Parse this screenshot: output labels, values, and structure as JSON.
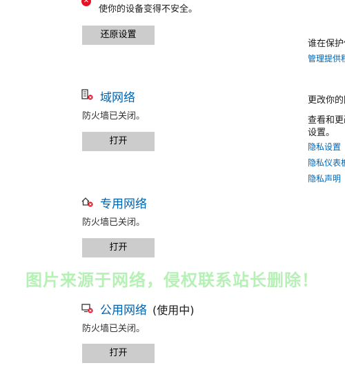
{
  "warning": {
    "icon": "error-circle-icon",
    "text": "使你的设备变得不安全。"
  },
  "restore_button": "还原设置",
  "networks": [
    {
      "icon": "domain-network-icon",
      "title": "域网络",
      "suffix": "",
      "status": "防火墙已关闭。",
      "button": "打开"
    },
    {
      "icon": "private-network-icon",
      "title": "专用网络",
      "suffix": "",
      "status": "防火墙已关闭。",
      "button": "打开"
    },
    {
      "icon": "public-network-icon",
      "title": "公用网络",
      "suffix": "(使用中)",
      "status": "防火墙已关闭。",
      "button": "打开"
    }
  ],
  "sidebar": {
    "protect_heading": "谁在保护你",
    "manage_link": "管理提供程序",
    "change_heading": "更改你的隐私设置",
    "view_text_line1": "查看和更改",
    "view_text_line2": "设置。",
    "links": [
      "隐私设置",
      "隐私仪表板",
      "隐私声明"
    ]
  },
  "watermark": "图片来源于网络，侵权联系站长删除！",
  "colors": {
    "link": "#0063b1",
    "button_bg": "#cccccc",
    "error": "#e81123",
    "watermark": "#78e678"
  }
}
